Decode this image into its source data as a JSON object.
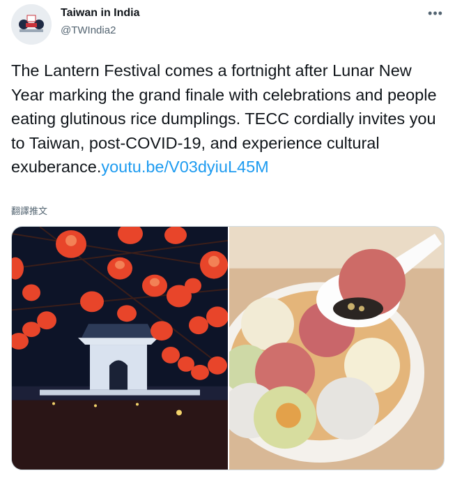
{
  "author": {
    "display_name": "Taiwan in India",
    "handle": "@TWIndia2",
    "avatar_icon": "taiwan-bears-avatar-icon"
  },
  "more_icon": "more-options-icon",
  "tweet": {
    "text": "The Lantern Festival comes a fortnight after Lunar New Year marking the grand finale with celebrations and people eating glutinous rice dumplings. TECC cordially invites you to Taiwan, post-COVID-19, and experience cultural exuberance.",
    "link_text": "youtu.be/V03dyiuL45M"
  },
  "translate_label": "翻譯推文",
  "media": {
    "left_photo_icon": "lantern-festival-photo",
    "right_photo_icon": "rice-dumpling-soup-photo"
  },
  "colors": {
    "link": "#1d9bf0",
    "secondary_text": "#536471",
    "lantern": "#e8452a"
  }
}
